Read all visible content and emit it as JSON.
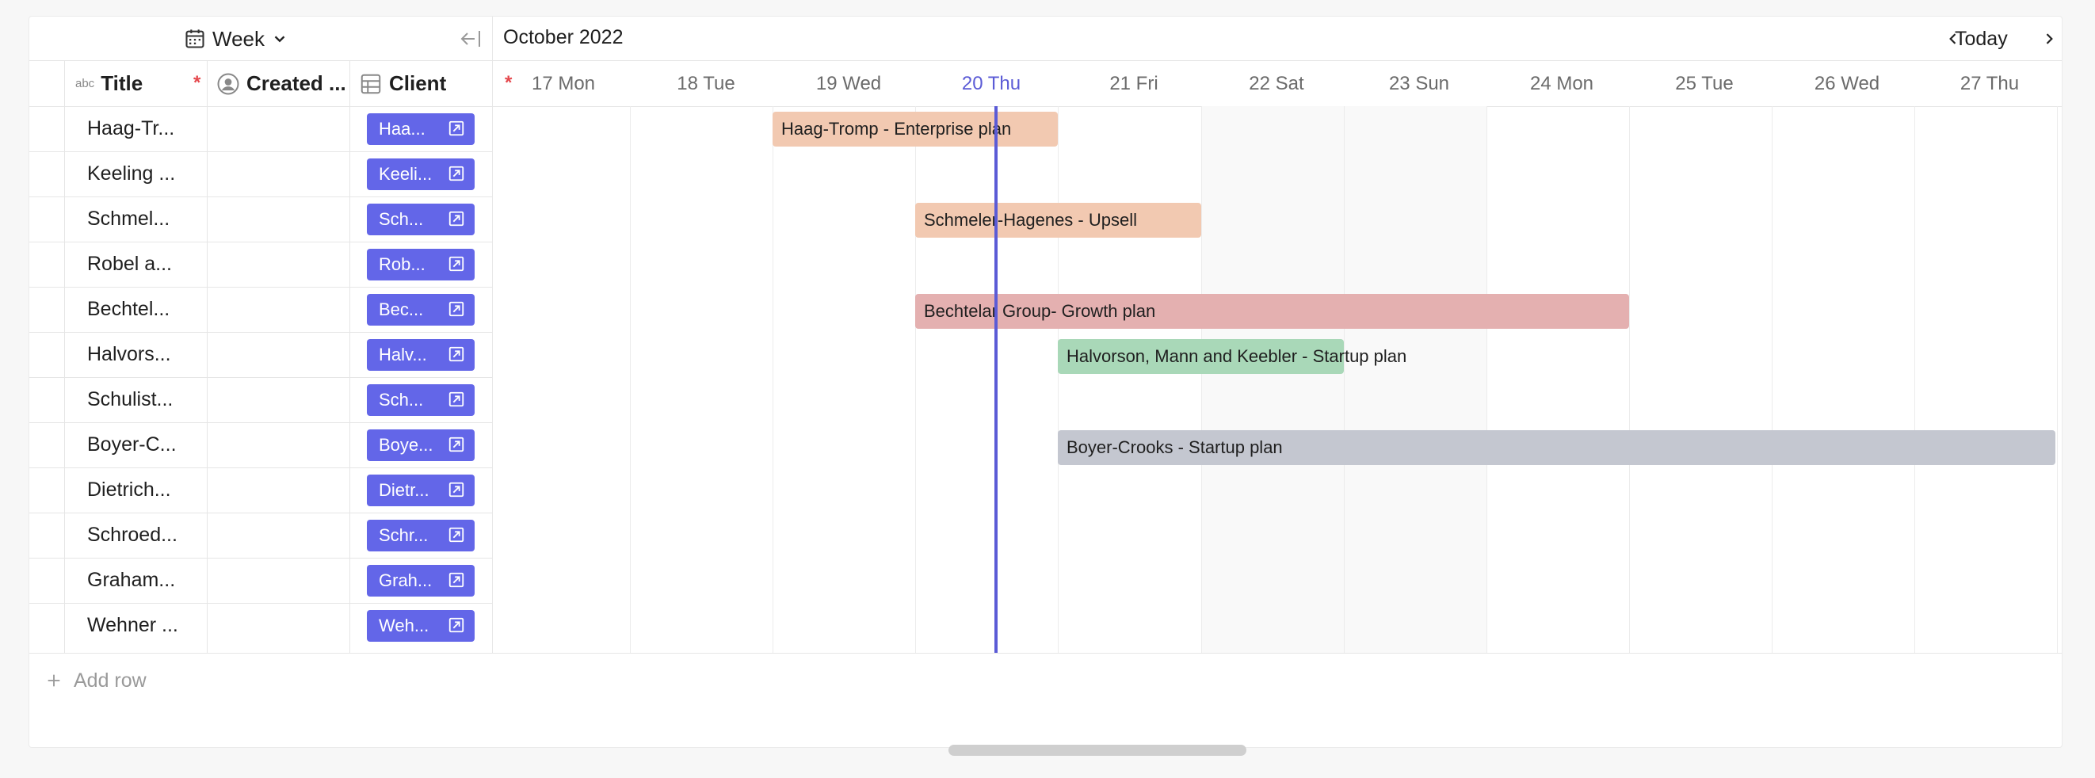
{
  "toolbar": {
    "view_label": "Week",
    "month_label": "October 2022",
    "today_label": "Today"
  },
  "columns": {
    "title": "Title",
    "title_type_icon": "abc",
    "created": "Created ...",
    "client": "Client",
    "required_mark": "*"
  },
  "days": [
    "17 Mon",
    "18 Tue",
    "19 Wed",
    "20 Thu",
    "21 Fri",
    "22 Sat",
    "23 Sun",
    "24 Mon",
    "25 Tue",
    "26 Wed",
    "27 Thu"
  ],
  "rows": [
    {
      "title": "Haag-Tr...",
      "client": "Haa..."
    },
    {
      "title": "Keeling ...",
      "client": "Keeli..."
    },
    {
      "title": "Schmel...",
      "client": "Sch..."
    },
    {
      "title": "Robel a...",
      "client": "Rob..."
    },
    {
      "title": "Bechtel...",
      "client": "Bec..."
    },
    {
      "title": "Halvors...",
      "client": "Halv..."
    },
    {
      "title": "Schulist...",
      "client": "Sch..."
    },
    {
      "title": "Boyer-C...",
      "client": "Boye..."
    },
    {
      "title": "Dietrich...",
      "client": "Dietr..."
    },
    {
      "title": "Schroed...",
      "client": "Schr..."
    },
    {
      "title": "Graham...",
      "client": "Grah..."
    },
    {
      "title": "Wehner ...",
      "client": "Weh..."
    }
  ],
  "bars": [
    {
      "label": "Haag-Tromp - Enterprise plan",
      "color": "#f2c9b1"
    },
    {
      "label": "Schmeler-Hagenes - Upsell",
      "color": "#f2c9b1"
    },
    {
      "label": "Bechtelar Group- Growth plan",
      "color": "#e4b0b0"
    },
    {
      "label": "Halvorson, Mann and Keebler - Startup plan",
      "color": "#a9d8b8"
    },
    {
      "label": "Boyer-Crooks - Startup plan",
      "color": "#c4c7d0"
    }
  ],
  "add_row_label": "Add row",
  "colors": {
    "accent": "#5b5bd6",
    "chip": "#6366e8",
    "required": "#e5484d"
  }
}
